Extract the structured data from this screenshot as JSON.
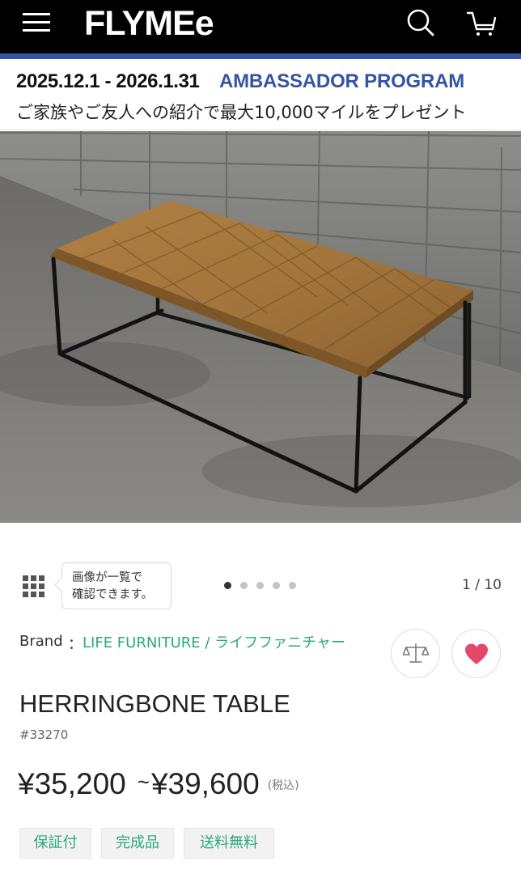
{
  "header": {
    "logo": "FLYMEe",
    "menu_icon": "hamburger-menu-icon",
    "search_icon": "search-icon",
    "cart_icon": "cart-icon",
    "background": "#000000",
    "accent": "#3454a4"
  },
  "promo": {
    "dates": "2025.12.1 - 2026.1.31",
    "title": "AMBASSADOR PROGRAM",
    "subtitle": "ご家族やご友人への紹介で最大10,000マイルをプレゼント"
  },
  "gallery": {
    "grid_icon": "grid-icon",
    "tooltip": [
      "画像が一覧で",
      "確認できます。"
    ],
    "dot_count": 5,
    "active_dot": 1,
    "page_count": "1 / 10"
  },
  "product": {
    "brand_label": "Brand",
    "brand_separator": "：",
    "brand_name": "LIFE FURNITURE / ライフファニチャー",
    "name": "HERRINGBONE TABLE",
    "id": "#33270",
    "price_min": "¥35,200",
    "price_sep": "~",
    "price_max": "¥39,600",
    "tax_note": "(税込)",
    "compare_icon": "scale-compare-icon",
    "favorite_icon": "heart-icon",
    "favorite_color": "#e34a6a",
    "brand_color": "#2aa97c",
    "tags": [
      "保証付",
      "完成品",
      "送料無料"
    ]
  }
}
